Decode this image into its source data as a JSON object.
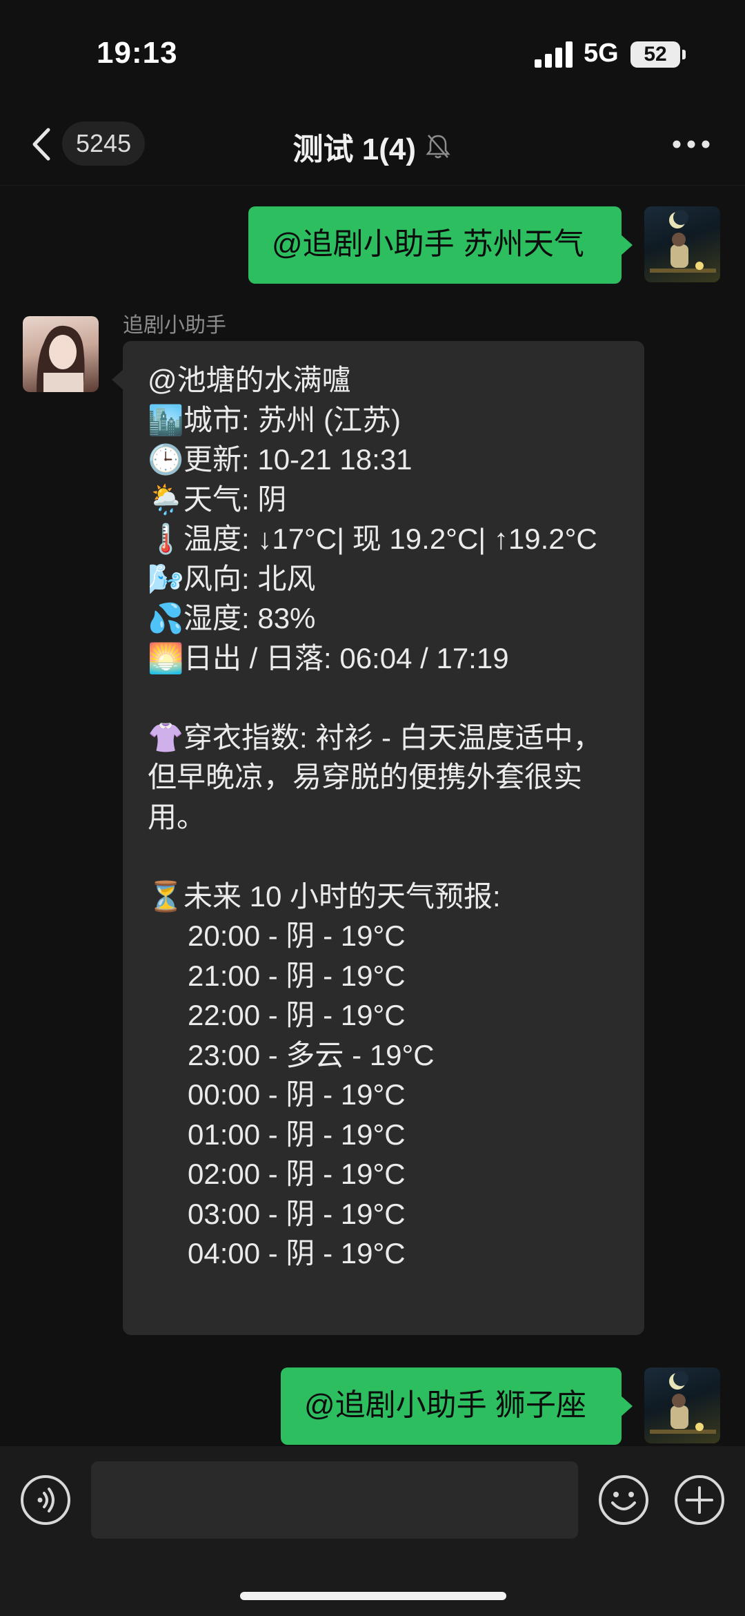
{
  "status_bar": {
    "time": "19:13",
    "network": "5G",
    "battery": "52"
  },
  "nav": {
    "back_count": "5245",
    "title": "测试 1(4)"
  },
  "messages": [
    {
      "from": "me",
      "text": "@追剧小助手 苏州天气"
    },
    {
      "from": "bot",
      "sender": "追剧小助手",
      "mention": "@池塘的水满嚧",
      "city": {
        "emoji": "🏙️",
        "text": "城市: 苏州 (江苏)"
      },
      "update": {
        "emoji": "🕒",
        "text": "更新: 10-21 18:31"
      },
      "weather": {
        "emoji": "🌦️",
        "text": "天气: 阴"
      },
      "temp": {
        "emoji": "🌡️",
        "text": "温度: ↓17°C| 现 19.2°C| ↑19.2°C"
      },
      "wind": {
        "emoji": "🌬️",
        "text": "风向: 北风"
      },
      "humidity": {
        "emoji": "💦",
        "text": "湿度: 83%"
      },
      "sun": {
        "emoji": "🌅",
        "text": "日出 / 日落: 06:04 / 17:19"
      },
      "clothing": {
        "emoji": "👚",
        "text": "穿衣指数: 衬衫 - 白天温度适中，但早晚凉，易穿脱的便携外套很实用。"
      },
      "forecast_title": {
        "emoji": "⏳",
        "text": "未来 10 小时的天气预报:"
      },
      "forecast": [
        "20:00 - 阴 - 19°C",
        "21:00 - 阴 - 19°C",
        "22:00 - 阴 - 19°C",
        "23:00 - 多云 - 19°C",
        "00:00 - 阴 - 19°C",
        "01:00 - 阴 - 19°C",
        "02:00 - 阴 - 19°C",
        "03:00 - 阴 - 19°C",
        "04:00 - 阴 - 19°C"
      ]
    },
    {
      "from": "me",
      "text": "@追剧小助手 狮子座"
    }
  ],
  "icons": {
    "back": "chevron-left-icon",
    "mute": "bell-off-icon",
    "more": "more-dots-icon",
    "voice": "voice-icon",
    "emoji": "emoji-icon",
    "plus": "plus-icon"
  },
  "colors": {
    "background": "#111111",
    "my_bubble": "#2dbe60",
    "bot_bubble": "#2b2b2b",
    "input_bar": "#1b1b1b"
  }
}
